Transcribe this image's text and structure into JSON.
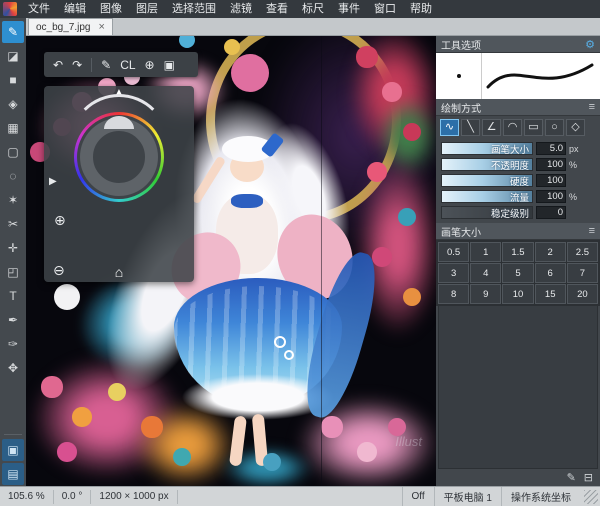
{
  "menu": {
    "items": [
      "文件",
      "编辑",
      "图像",
      "图层",
      "选择范围",
      "滤镜",
      "查看",
      "标尺",
      "事件",
      "窗口",
      "帮助"
    ]
  },
  "tab": {
    "title": "oc_bg_7.jpg",
    "close": "×"
  },
  "toolbar_left": {
    "tools": [
      {
        "name": "brush",
        "glyph": "✎"
      },
      {
        "name": "eraser",
        "glyph": "◪"
      },
      {
        "name": "fill",
        "glyph": "■"
      },
      {
        "name": "bucket",
        "glyph": "◈"
      },
      {
        "name": "gradient",
        "glyph": "▦"
      },
      {
        "name": "select-rect",
        "glyph": "▢"
      },
      {
        "name": "lasso",
        "glyph": "◌"
      },
      {
        "name": "magic-wand",
        "glyph": "✶"
      },
      {
        "name": "select-pen",
        "glyph": "✂"
      },
      {
        "name": "move",
        "glyph": "✛"
      },
      {
        "name": "transform",
        "glyph": "◰"
      },
      {
        "name": "text",
        "glyph": "T"
      },
      {
        "name": "pen",
        "glyph": "✒"
      },
      {
        "name": "eyedropper",
        "glyph": "✑"
      },
      {
        "name": "hand",
        "glyph": "✥"
      }
    ],
    "bottom": [
      {
        "name": "panel-toggle-1",
        "glyph": "▣"
      },
      {
        "name": "panel-toggle-2",
        "glyph": "▤"
      }
    ]
  },
  "floating_toolbar": {
    "items": [
      {
        "name": "undo",
        "glyph": "↶"
      },
      {
        "name": "redo",
        "glyph": "↷"
      },
      {
        "name": "brush",
        "glyph": "✎"
      },
      {
        "name": "clear",
        "glyph": "CL"
      },
      {
        "name": "crosshair",
        "glyph": "⊕"
      },
      {
        "name": "window",
        "glyph": "▣"
      }
    ]
  },
  "wheel": {
    "reset": "▲",
    "left": "▶",
    "zoom_tool": "⊕",
    "zoom_out": "⊖",
    "home": "⌂"
  },
  "right_panel": {
    "tool_options": {
      "title": "工具选项",
      "gear": "⚙"
    },
    "draw_mode": {
      "title": "绘制方式",
      "menu_icon": "≡",
      "modes": [
        {
          "name": "freehand",
          "glyph": "∿"
        },
        {
          "name": "line",
          "glyph": "╲"
        },
        {
          "name": "polyline",
          "glyph": "∠"
        },
        {
          "name": "curve",
          "glyph": "◠"
        },
        {
          "name": "rectangle",
          "glyph": "▭"
        },
        {
          "name": "ellipse",
          "glyph": "○"
        },
        {
          "name": "polygon",
          "glyph": "◇"
        }
      ]
    },
    "sliders": [
      {
        "label": "画笔大小",
        "value": "5.0",
        "unit": "px"
      },
      {
        "label": "不透明度",
        "value": "100",
        "unit": "%"
      },
      {
        "label": "硬度",
        "value": "100",
        "unit": ""
      },
      {
        "label": "流量",
        "value": "100",
        "unit": "%"
      }
    ],
    "stabilizer": {
      "label": "稳定级别",
      "value": "0"
    },
    "brush_sizes": {
      "title": "画笔大小",
      "menu_icon": "≡",
      "sizes": [
        "0.5",
        "1",
        "1.5",
        "2",
        "2.5",
        "3",
        "4",
        "5",
        "6",
        "7",
        "8",
        "9",
        "10",
        "15",
        "20"
      ],
      "add_icon": "✎",
      "delete_icon": "⊟"
    }
  },
  "status_bar": {
    "zoom": "105.6 %",
    "rotation": "0.0 °",
    "size": "1200 × 1000 px",
    "off": "Off",
    "tablet": "平板电脑 1",
    "coords": "操作系统坐标"
  },
  "canvas": {
    "watermark": "Illust"
  }
}
